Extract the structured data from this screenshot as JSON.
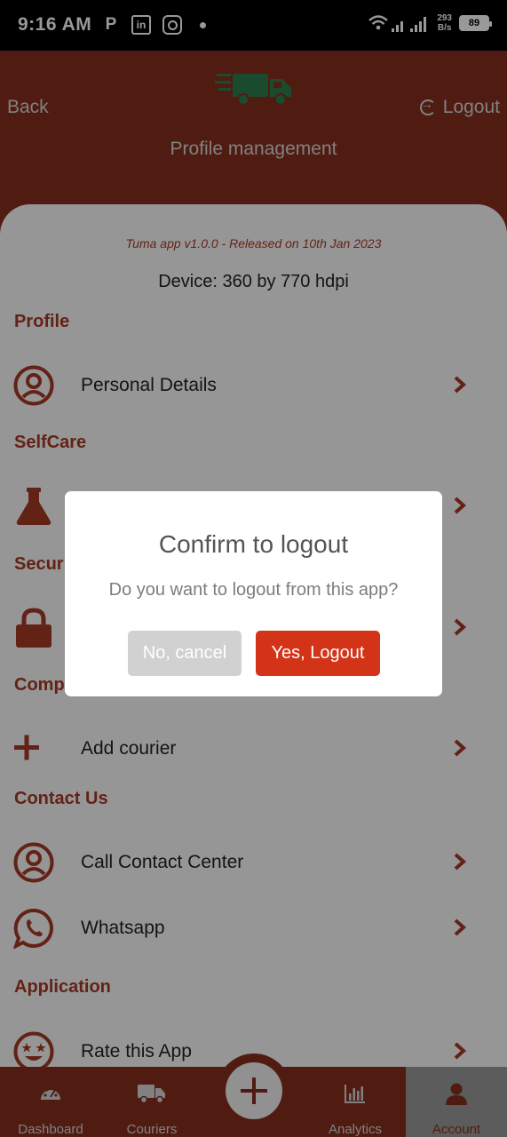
{
  "status_bar": {
    "time": "9:16 AM",
    "net_speed_value": "293",
    "net_speed_unit": "B/s",
    "battery": "89"
  },
  "header": {
    "back_label": "Back",
    "logout_label": "Logout",
    "title": "Profile management"
  },
  "info": {
    "version": "Tuma app v1.0.0 - Released on 10th Jan 2023",
    "device": "Device: 360 by 770 hdpi"
  },
  "sections": {
    "profile": "Profile",
    "selfcare": "SelfCare",
    "security": "Secur",
    "company": "Comp",
    "contact": "Contact Us",
    "application": "Application"
  },
  "rows": {
    "personal_details": "Personal Details",
    "add_courier": "Add courier",
    "call_center": "Call Contact Center",
    "whatsapp": "Whatsapp",
    "rate_app": "Rate this App"
  },
  "dialog": {
    "title": "Confirm to logout",
    "message": "Do you want to logout from this app?",
    "cancel_label": "No, cancel",
    "confirm_label": "Yes, Logout"
  },
  "bottom_nav": {
    "dashboard": "Dashboard",
    "couriers": "Couriers",
    "analytics": "Analytics",
    "account": "Account",
    "active": "Account"
  },
  "colors": {
    "brand": "#85301f",
    "accent": "#a53a26",
    "confirm": "#d33317",
    "truck": "#2e7d4f"
  }
}
